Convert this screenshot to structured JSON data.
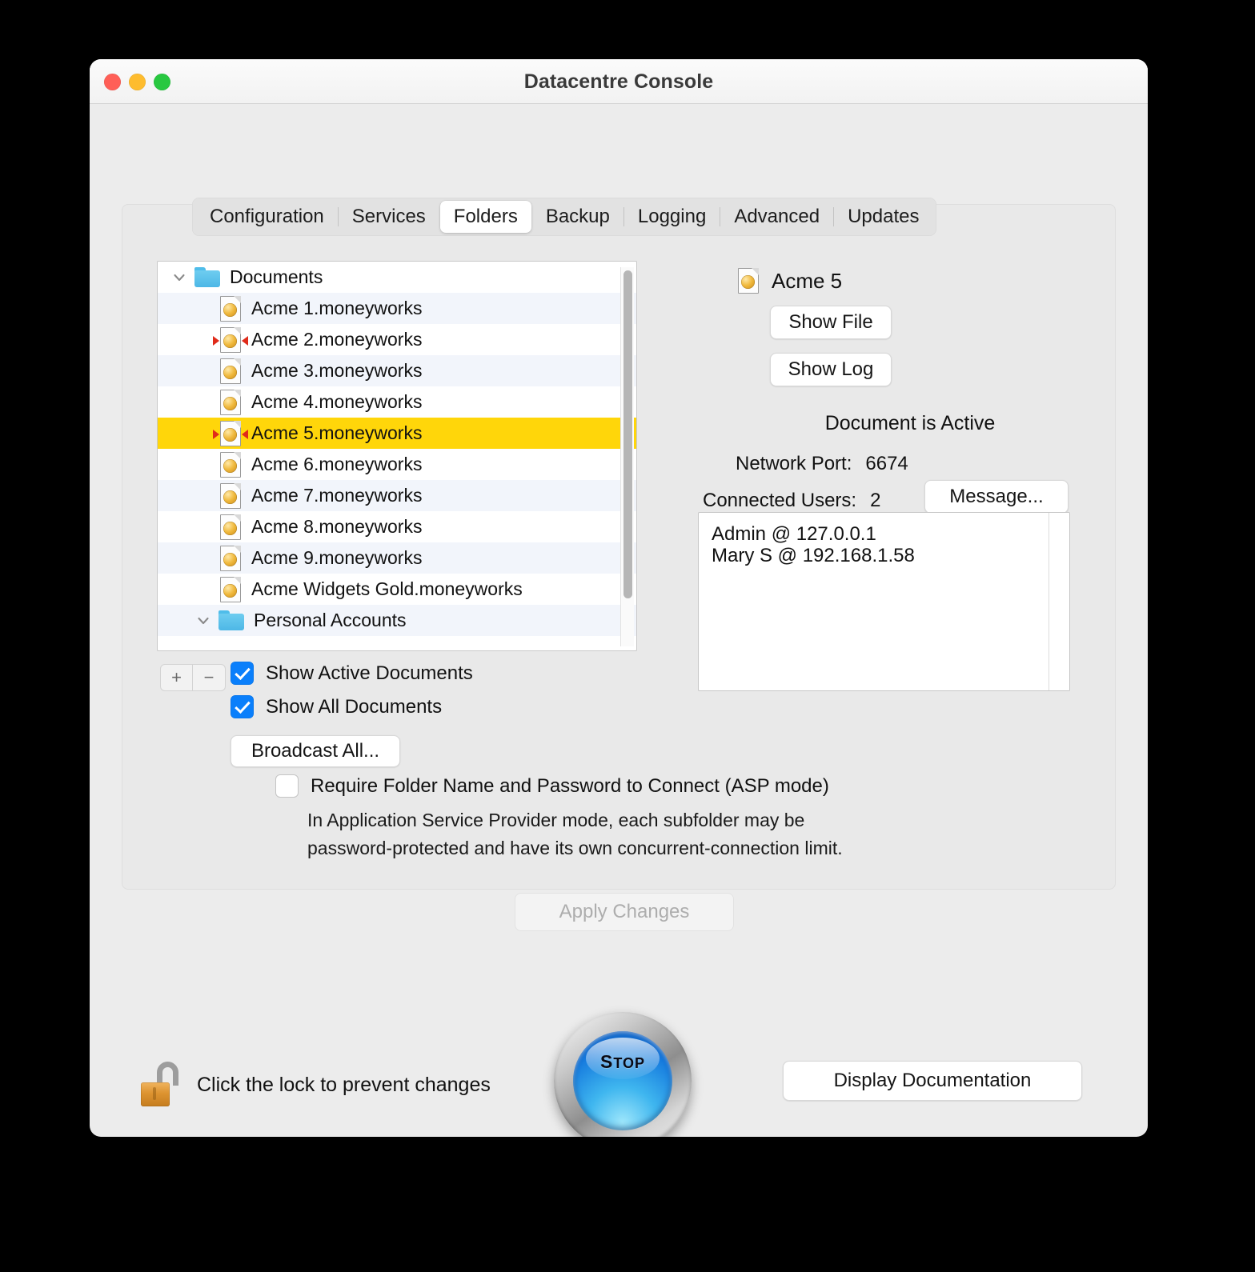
{
  "window": {
    "title": "Datacentre Console",
    "traffic_lights": [
      "close",
      "minimize",
      "zoom"
    ]
  },
  "tabs": [
    {
      "label": "Configuration",
      "active": false
    },
    {
      "label": "Services",
      "active": false
    },
    {
      "label": "Folders",
      "active": true
    },
    {
      "label": "Backup",
      "active": false
    },
    {
      "label": "Logging",
      "active": false
    },
    {
      "label": "Advanced",
      "active": false
    },
    {
      "label": "Updates",
      "active": false
    }
  ],
  "tree": {
    "rows": [
      {
        "label": "Documents",
        "kind": "folder",
        "expanded": true,
        "selected": false,
        "alt": false,
        "active": false
      },
      {
        "label": "Acme 1.moneyworks",
        "kind": "doc",
        "expanded": false,
        "selected": false,
        "alt": true,
        "active": false
      },
      {
        "label": "Acme 2.moneyworks",
        "kind": "doc",
        "expanded": false,
        "selected": false,
        "alt": false,
        "active": true
      },
      {
        "label": "Acme 3.moneyworks",
        "kind": "doc",
        "expanded": false,
        "selected": false,
        "alt": true,
        "active": false
      },
      {
        "label": "Acme 4.moneyworks",
        "kind": "doc",
        "expanded": false,
        "selected": false,
        "alt": false,
        "active": false
      },
      {
        "label": "Acme 5.moneyworks",
        "kind": "doc",
        "expanded": false,
        "selected": true,
        "alt": false,
        "active": true
      },
      {
        "label": "Acme 6.moneyworks",
        "kind": "doc",
        "expanded": false,
        "selected": false,
        "alt": false,
        "active": false
      },
      {
        "label": "Acme 7.moneyworks",
        "kind": "doc",
        "expanded": false,
        "selected": false,
        "alt": true,
        "active": false
      },
      {
        "label": "Acme 8.moneyworks",
        "kind": "doc",
        "expanded": false,
        "selected": false,
        "alt": false,
        "active": false
      },
      {
        "label": "Acme 9.moneyworks",
        "kind": "doc",
        "expanded": false,
        "selected": false,
        "alt": true,
        "active": false
      },
      {
        "label": "Acme Widgets Gold.moneyworks",
        "kind": "doc",
        "expanded": false,
        "selected": false,
        "alt": false,
        "active": false
      },
      {
        "label": "Personal Accounts",
        "kind": "subfolder",
        "expanded": true,
        "selected": false,
        "alt": true,
        "active": false
      }
    ]
  },
  "list_controls": {
    "add_label": "+",
    "remove_label": "−",
    "show_active_documents": {
      "label": "Show Active Documents",
      "checked": true
    },
    "show_all_documents": {
      "label": "Show All Documents",
      "checked": true
    },
    "broadcast_all_label": "Broadcast All..."
  },
  "asp": {
    "checkbox_label": "Require Folder Name and Password to Connect (ASP mode)",
    "checked": false,
    "description": "In Application Service Provider mode, each subfolder may be\npassword-protected and have its own concurrent-connection limit."
  },
  "detail": {
    "document_name": "Acme 5",
    "show_file_label": "Show File",
    "show_log_label": "Show Log",
    "status": "Document is Active",
    "network_port_label": "Network Port:",
    "network_port_value": "6674",
    "connected_users_label": "Connected Users:",
    "connected_users_value": "2",
    "message_label": "Message...",
    "connected_users": [
      "Admin @ 127.0.0.1",
      "Mary S @ 192.168.1.58"
    ]
  },
  "footer": {
    "apply_changes_label": "Apply Changes",
    "apply_changes_enabled": false,
    "lock_text": "Click the lock to prevent changes",
    "lock_state": "unlocked",
    "stop_button_label": "STOP",
    "display_documentation_label": "Display Documentation"
  },
  "colors": {
    "selection_yellow": "#ffd60a",
    "checkbox_blue": "#0a7ffb",
    "stop_blue": "#1478dd",
    "folder_blue": "#4db7e6",
    "active_marker_red": "#e02b1a",
    "window_bg": "#ececec"
  }
}
